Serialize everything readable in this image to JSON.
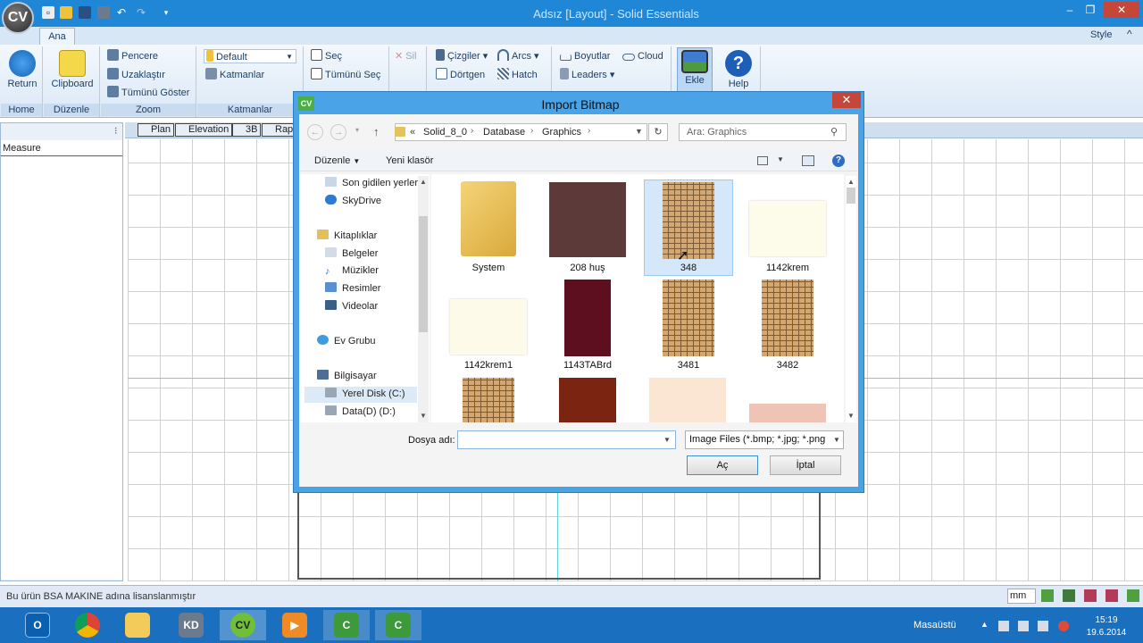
{
  "app": {
    "title": "Adsız [Layout] - Solid Essentials",
    "logo": "CV"
  },
  "ribbon": {
    "tab_active": "Ana",
    "style_label": "Style",
    "groups": {
      "home": "Home",
      "duzenle": "Düzenle",
      "zoom": "Zoom",
      "katmanlar": "Katmanlar"
    },
    "buttons": {
      "return": "Return",
      "clipboard": "Clipboard",
      "pencere": "Pencere",
      "uzaklastir": "Uzaklaştır",
      "tumunu_goster": "Tümünü Göster",
      "layer_default": "Default",
      "katmanlar": "Katmanlar",
      "sec": "Seç",
      "tumunu_sec": "Tümünü Seç",
      "sil": "Sil",
      "cizgiler": "Çizgiler",
      "dortgen": "Dörtgen",
      "arcs": "Arcs",
      "hatch": "Hatch",
      "boyutlar": "Boyutlar",
      "leaders": "Leaders",
      "cloud": "Cloud",
      "ekle": "Ekle",
      "help": "Help"
    }
  },
  "left_panel": {
    "header": "Measure"
  },
  "view_tabs": [
    "Plan",
    "Elevation",
    "3B",
    "Rap"
  ],
  "status": {
    "license": "Bu ürün BSA MAKINE adına lisanslanmıştır",
    "unit": "mm"
  },
  "dialog": {
    "title": "Import Bitmap",
    "breadcrumb": [
      "«",
      "Solid_8_0",
      "Database",
      "Graphics"
    ],
    "search_placeholder": "Ara: Graphics",
    "toolbar": {
      "organize": "Düzenle",
      "new_folder": "Yeni klasör"
    },
    "nav_items": [
      "Son gidilen yerler",
      "SkyDrive",
      "Kitaplıklar",
      "Belgeler",
      "Müzikler",
      "Resimler",
      "Videolar",
      "Ev Grubu",
      "Bilgisayar",
      "Yerel Disk (C:)",
      "Data(D) (D:)"
    ],
    "files": [
      "System",
      "208 huş",
      "348",
      "1142krem",
      "1142krem1",
      "1143TABrd",
      "3481",
      "3482"
    ],
    "file_name_label": "Dosya adı:",
    "file_name_value": "",
    "file_type": "Image Files (*.bmp; *.jpg; *.png",
    "open_button": "Aç",
    "cancel_button": "İptal",
    "colors": {
      "frame": "#4aa3e6",
      "selected_tile": "#d5e8fb"
    }
  },
  "taskbar": {
    "desktop_label": "Masaüstü",
    "time": "15:19",
    "date": "19.6.2014"
  }
}
